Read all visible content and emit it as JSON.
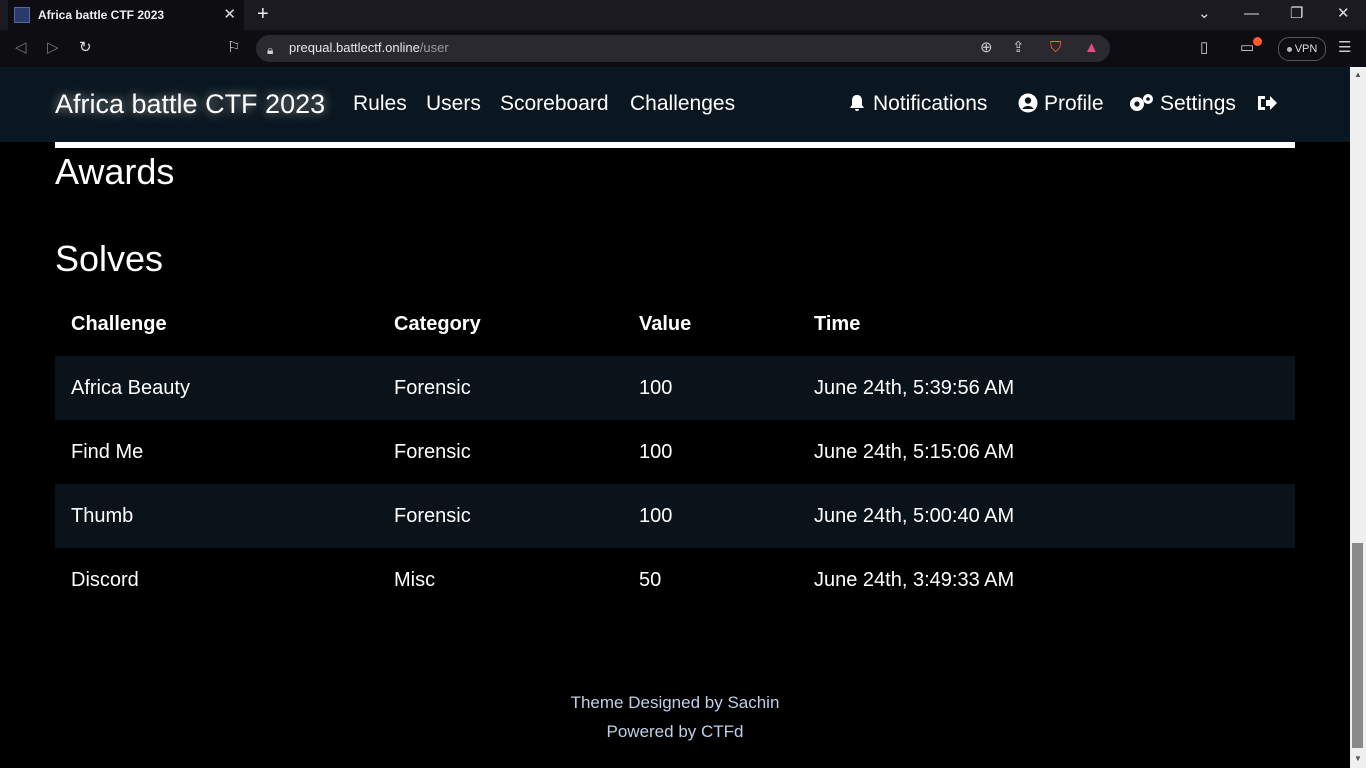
{
  "browser": {
    "tab_title": "Africa battle CTF 2023",
    "url_host": "prequal.battlectf.online",
    "url_path": "/user",
    "vpn_label": "VPN"
  },
  "navbar": {
    "brand": "Africa battle CTF 2023",
    "links": [
      "Rules",
      "Users",
      "Scoreboard",
      "Challenges"
    ],
    "notifications": "Notifications",
    "profile": "Profile",
    "settings": "Settings"
  },
  "awards": {
    "heading": "Awards"
  },
  "solves": {
    "heading": "Solves",
    "columns": [
      "Challenge",
      "Category",
      "Value",
      "Time"
    ],
    "rows": [
      [
        "Africa Beauty",
        "Forensic",
        "100",
        "June 24th, 5:39:56 AM"
      ],
      [
        "Find Me",
        "Forensic",
        "100",
        "June 24th, 5:15:06 AM"
      ],
      [
        "Thumb",
        "Forensic",
        "100",
        "June 24th, 5:00:40 AM"
      ],
      [
        "Discord",
        "Misc",
        "50",
        "June 24th, 3:49:33 AM"
      ]
    ]
  },
  "footer": {
    "line1": "Theme Designed by Sachin",
    "line2": "Powered by CTFd"
  },
  "icons": {
    "notifications": "bell-icon",
    "profile": "user-circle-icon",
    "settings": "gears-icon",
    "logout": "sign-out-icon"
  },
  "colors": {
    "navbar_bg": "#0b1720",
    "page_bg": "#000000",
    "row_stripe": "#0a121a",
    "footer_text": "#bcd0e8"
  }
}
